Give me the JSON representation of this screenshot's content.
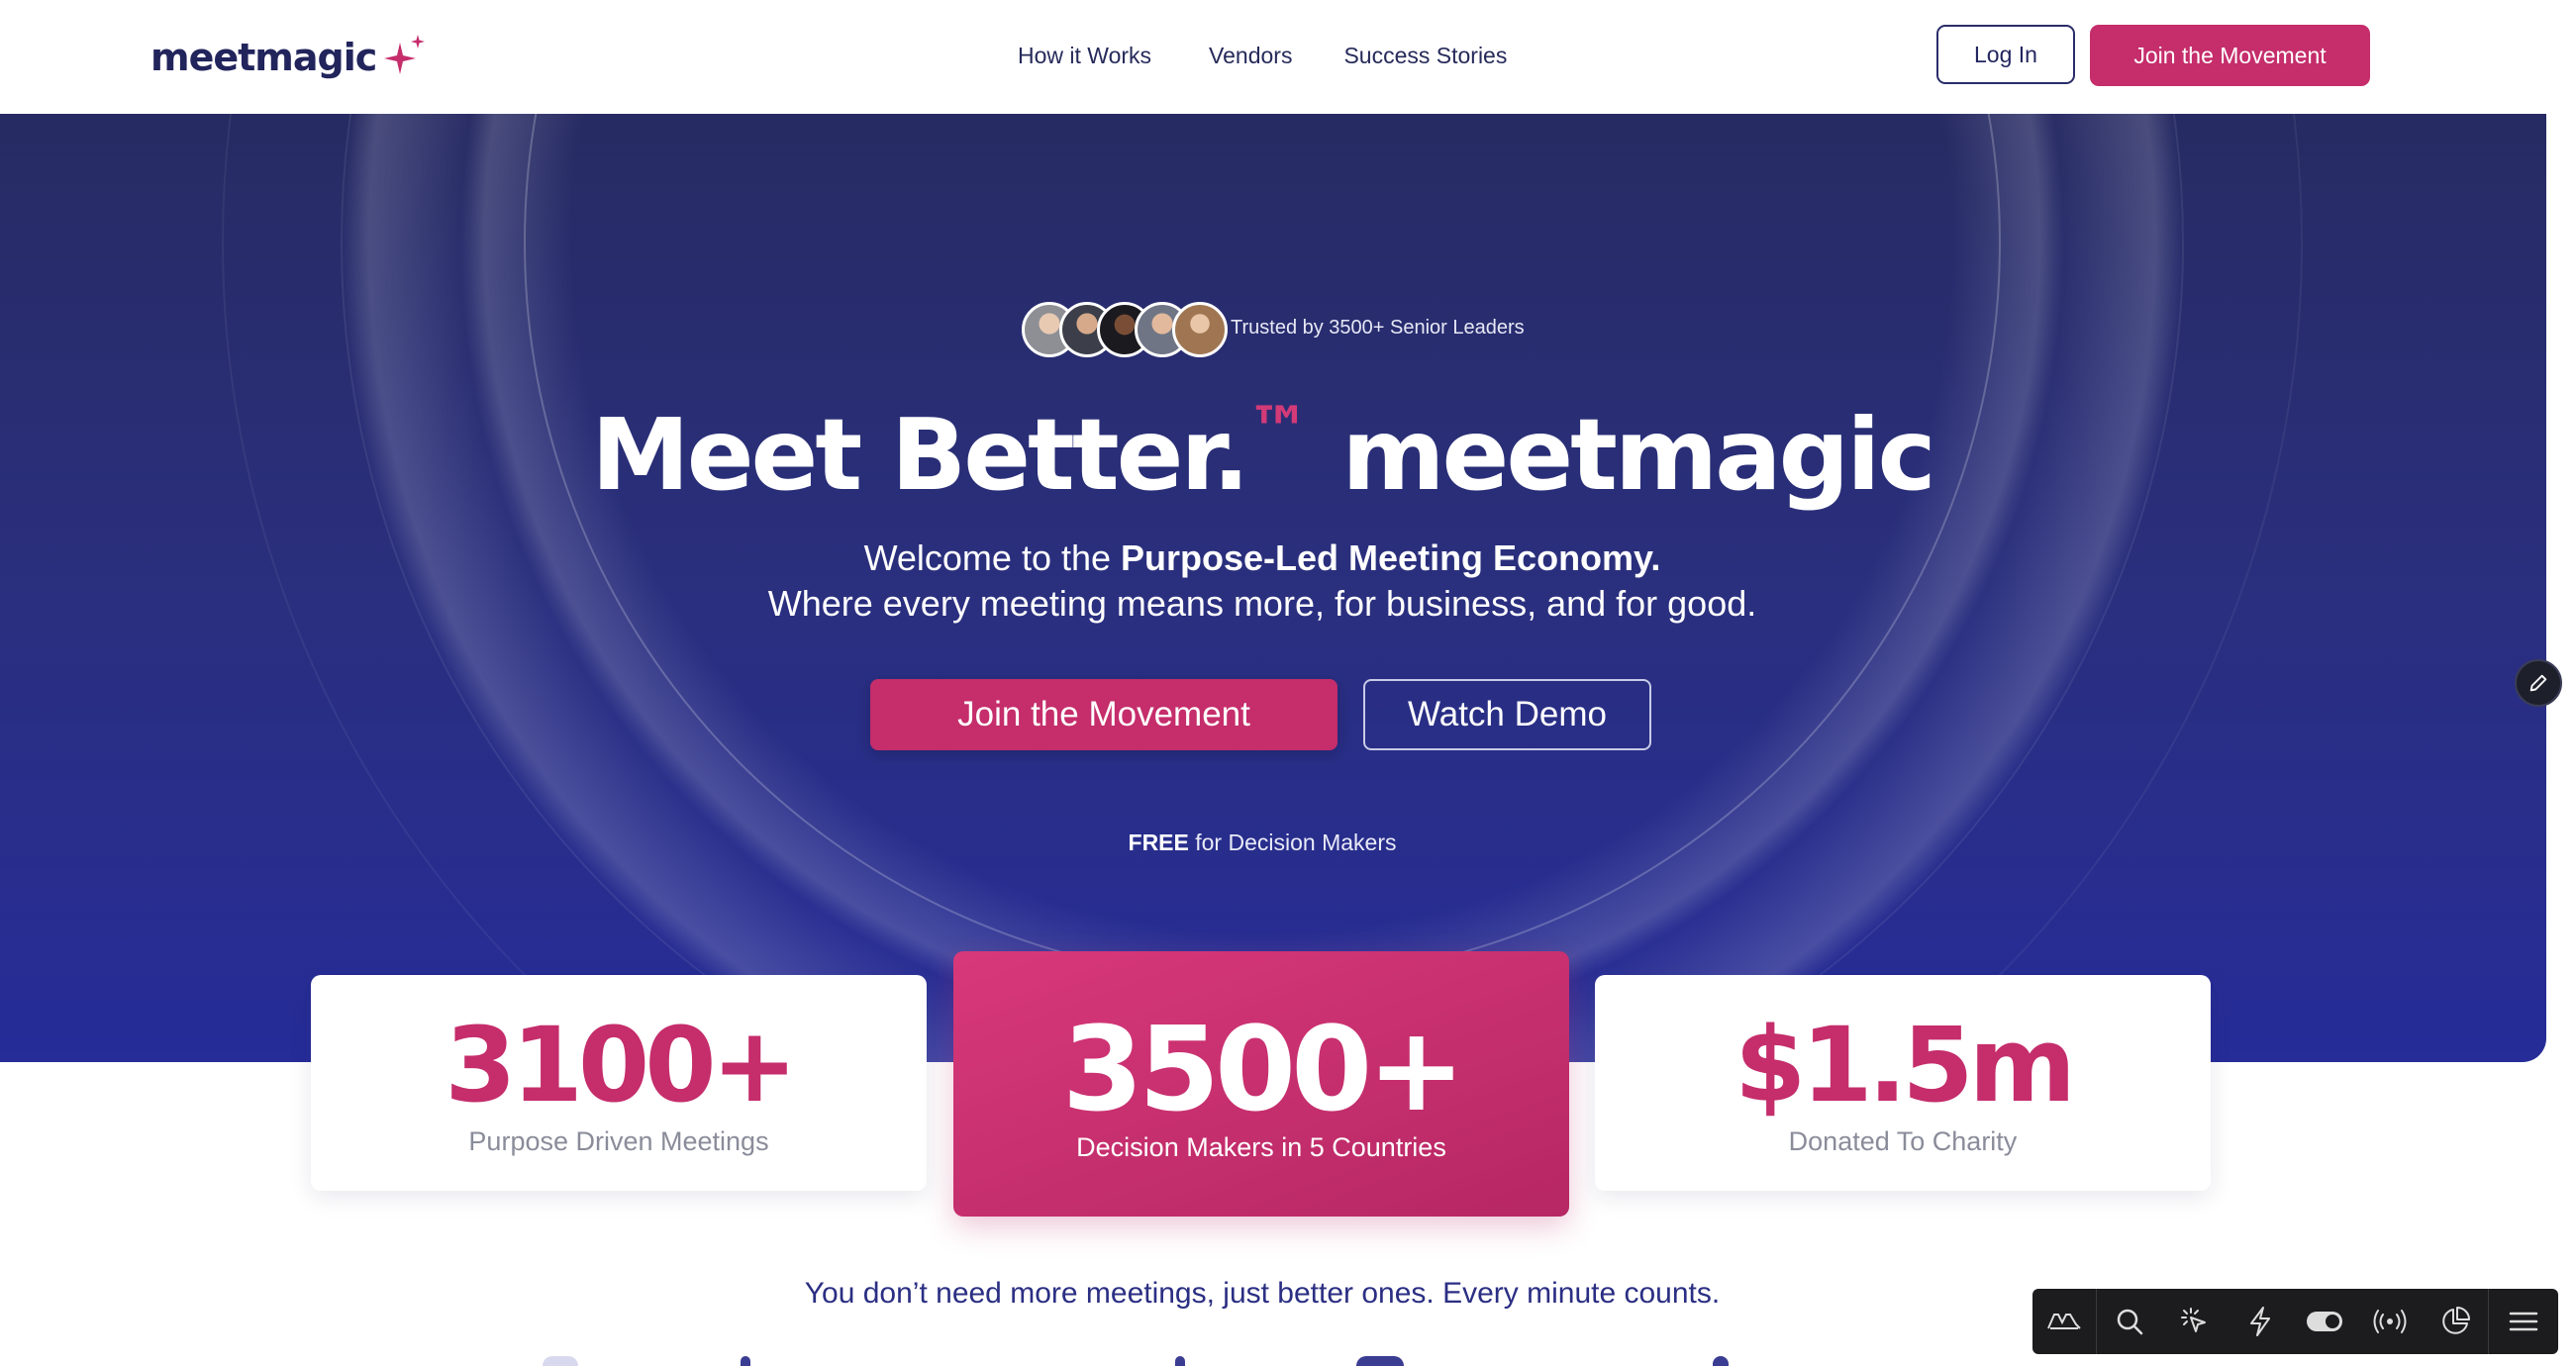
{
  "header": {
    "brand": "meetmagic",
    "nav": [
      "How it Works",
      "Vendors",
      "Success Stories"
    ],
    "login_label": "Log In",
    "cta_label": "Join the Movement"
  },
  "hero": {
    "trusted_text": "Trusted by 3500+ Senior Leaders",
    "headline_main": "Meet Better.",
    "headline_tm": "™",
    "headline_brand": "meetmagic",
    "subtitle_prefix": "Welcome to the ",
    "subtitle_bold": "Purpose-Led Meeting Economy.",
    "subtitle_line2": "Where every meeting means more, for business, and for good.",
    "cta_primary": "Join the Movement",
    "cta_secondary": "Watch Demo",
    "free_bold": "FREE",
    "free_rest": " for Decision Makers"
  },
  "stats": [
    {
      "value": "3100+",
      "label": "Purpose Driven Meetings"
    },
    {
      "value": "3500+",
      "label": "Decision Makers in 5 Countries"
    },
    {
      "value": "$1.5m",
      "label": "Donated To Charity"
    }
  ],
  "tagline": "You don’t need more meetings, just better ones. Every minute counts.",
  "colors": {
    "brand_pink": "#c52d6b",
    "navy": "#22245c",
    "hero_top": "#272b63",
    "hero_bottom": "#262c98"
  },
  "toolbar": {
    "icons": [
      "astro-logo-icon",
      "search-icon",
      "pointer-icon",
      "lightning-icon",
      "toggle-icon",
      "broadcast-icon",
      "pie-chart-icon",
      "menu-icon"
    ]
  }
}
